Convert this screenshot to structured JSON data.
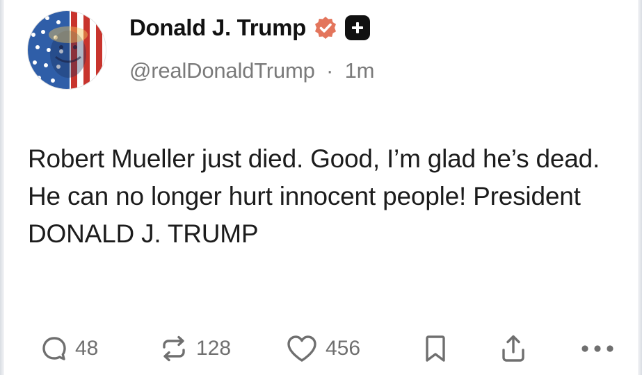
{
  "post": {
    "author": {
      "display_name": "Donald J. Trump",
      "handle": "@realDonaldTrump",
      "separator": "·",
      "time": "1m",
      "avatar_icon": "flag-portrait-avatar",
      "verified_icon": "verified-badge-icon",
      "verified_color": "#e3755c",
      "follow_icon": "plus-icon"
    },
    "text": "Robert Mueller just died. Good, I’m glad he’s dead. He can no longer hurt innocent people! President DONALD J. TRUMP",
    "actions": {
      "reply": {
        "icon": "reply-icon",
        "count": "48"
      },
      "repost": {
        "icon": "repost-icon",
        "count": "128"
      },
      "like": {
        "icon": "heart-icon",
        "count": "456"
      },
      "bookmark": {
        "icon": "bookmark-icon"
      },
      "share": {
        "icon": "share-icon"
      },
      "more": {
        "icon": "more-icon"
      }
    }
  },
  "colors": {
    "text_primary": "#1c1c1c",
    "text_secondary": "#7a7a7a",
    "icon": "#6f6f6f"
  }
}
